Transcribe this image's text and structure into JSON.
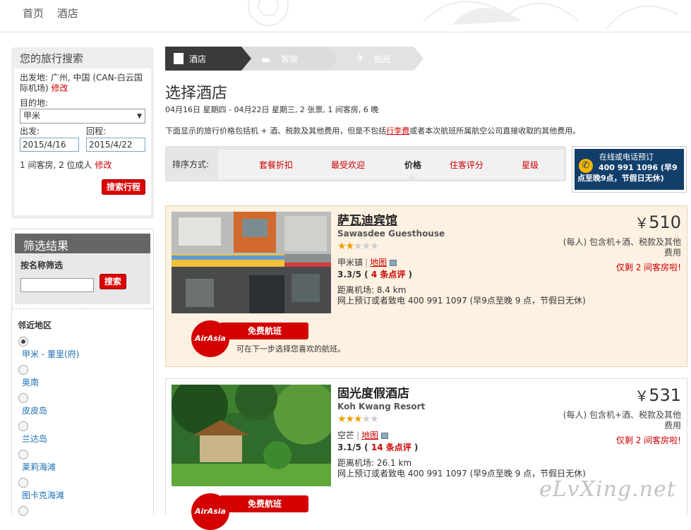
{
  "nav": {
    "home": "首页",
    "hotel": "酒店"
  },
  "search": {
    "title": "您的旅行搜索",
    "from_label": "出发地:",
    "from_value": "广州, 中国 (CAN-白云国际机场)",
    "edit": "修改",
    "dest_label": "目的地:",
    "dest_value": "甲米",
    "depart_label": "出发:",
    "return_label": "回程:",
    "depart_value": "2015/4/16",
    "return_value": "2015/4/22",
    "rooms": "1 间客房, 2 位成人",
    "edit2": "修改",
    "button": "搜索行程"
  },
  "filter": {
    "title": "筛选结果",
    "name_label": "按名称筛选",
    "search_btn": "搜索",
    "near_title": "邻近地区",
    "areas": [
      "甲米 - 董里(府)",
      "奥南",
      "皮皮岛",
      "兰达岛",
      "莱莉海滩",
      "图卡克海滩",
      ""
    ]
  },
  "steps": {
    "hotel": "酒店",
    "room": "客房",
    "flight": "航班"
  },
  "page": {
    "title": "选择酒店",
    "dates": "04月16日 星期四 - 04月22日 星期三, 2 张票, 1 间客房, 6 晚",
    "note_a": "下面显示的旅行价格包括机 + 酒、税款及其他费用，但是不包括",
    "note_link": "行李费",
    "note_b": "或者本次航班所属航空公司直接收取的其他费用。"
  },
  "sort": {
    "label": "排序方式:",
    "options": [
      "套餐折扣",
      "最受欢迎",
      "价格",
      "住客评分",
      "星级"
    ]
  },
  "phone_box": {
    "line1": "在线或电话预订",
    "line2": "400 991 1096 (早9",
    "line3": "点至晚9点，节假日无休)"
  },
  "hotels": [
    {
      "name": "萨瓦迪宾馆",
      "en": "Sawasdee Guesthouse",
      "stars": 2,
      "area": "甲米镇",
      "map": "地图",
      "rating": "3.3/5",
      "reviews": "4 条点评",
      "distance": "距离机场:  8.4 km",
      "phone": "网上预订或者致电 400 991 1097 (早9点至晚 9 点，节假日无休)",
      "currency": "￥",
      "price": "510",
      "price_note": "(每人) 包含机+酒、税款及其他费用",
      "rooms_left": "仅剩 2 间客房啦!",
      "air_logo": "AirAsia",
      "air_label": "免费航班",
      "air_note": "可在下一步选择您喜欢的航班。"
    },
    {
      "name": "固光度假酒店",
      "en": "Koh Kwang Resort",
      "stars": 3,
      "area": "空芒",
      "map": "地图",
      "rating": "3.1/5",
      "reviews": "14 条点评",
      "distance": "距离机场:  26.1 km",
      "phone": "网上预订或者致电 400 991 1097 (早9点至晚 9 点，节假日无休)",
      "currency": "￥",
      "price": "531",
      "price_note": "(每人) 包含机+酒、税款及其他费用",
      "rooms_left": "仅剩 2 间客房啦!",
      "air_logo": "AirAsia",
      "air_label": "免费航班"
    }
  ],
  "watermark": "eLvXing.net",
  "colors": {
    "accent": "#cc0000",
    "nav_active": "#333333",
    "phone_bg": "#123f6a",
    "highlight_bg": "#fdf1e2"
  }
}
